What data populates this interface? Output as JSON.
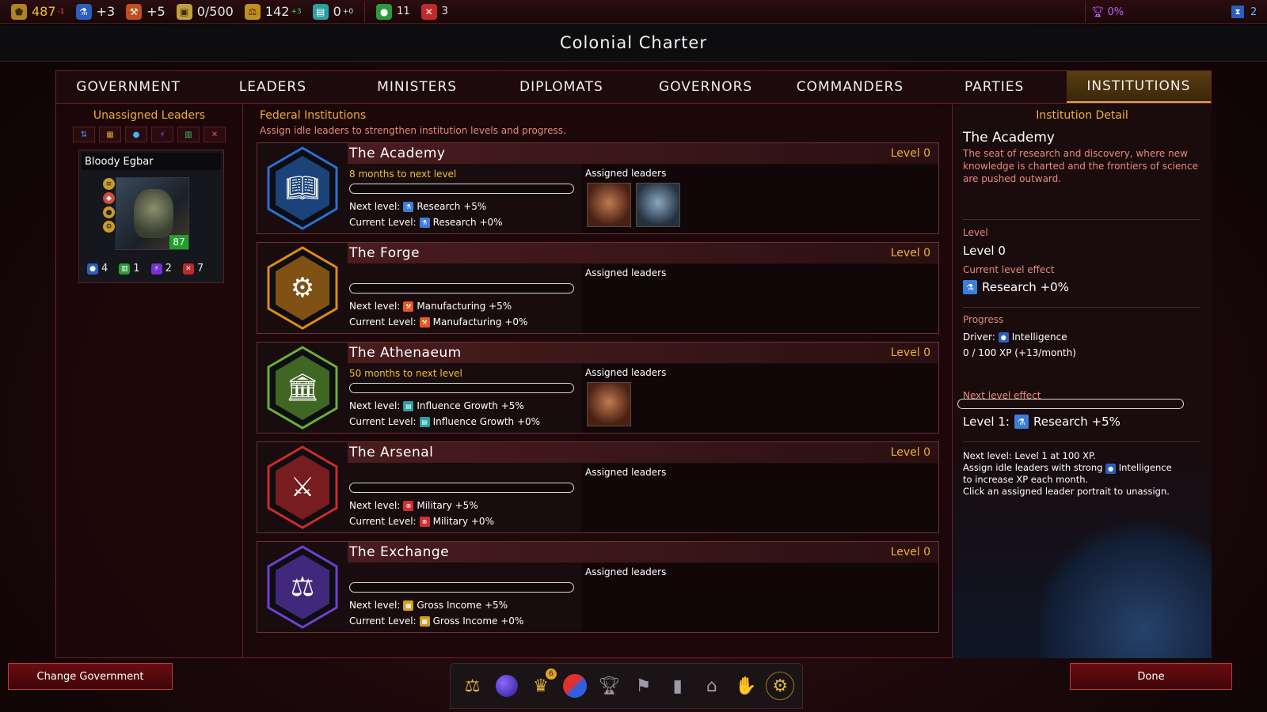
{
  "resources": [
    {
      "name": "credits",
      "value": "487",
      "delta": "-1",
      "color": "#f0c030",
      "delta_color": "#ff5050",
      "icon": "pentagon-coin-icon"
    },
    {
      "name": "research",
      "value": "+3",
      "delta": "",
      "color": "#ffffff",
      "icon": "flask-icon"
    },
    {
      "name": "manufacturing",
      "value": "+5",
      "delta": "",
      "color": "#ffffff",
      "icon": "hammer-icon"
    },
    {
      "name": "storage",
      "value": "0/500",
      "delta": "",
      "color": "#ffffff",
      "icon": "crate-icon"
    },
    {
      "name": "influence",
      "value": "142",
      "delta": "+3",
      "color": "#ffffff",
      "delta_color": "#40e040",
      "icon": "scales-icon"
    },
    {
      "name": "population",
      "value": "0",
      "delta": "+0",
      "color": "#ffffff",
      "delta_color": "#ffffff",
      "icon": "building-icon"
    }
  ],
  "resources_small": [
    {
      "name": "food",
      "value": "11",
      "icon": "apple-icon"
    },
    {
      "name": "unrest",
      "value": "3",
      "icon": "cross-swords-icon"
    }
  ],
  "topright": {
    "victory": "0%",
    "turns": "2"
  },
  "title": "Colonial Charter",
  "tabs": [
    "GOVERNMENT",
    "LEADERS",
    "MINISTERS",
    "DIPLOMATS",
    "GOVERNORS",
    "COMMANDERS",
    "PARTIES",
    "INSTITUTIONS"
  ],
  "active_tab": 7,
  "left": {
    "header": "Unassigned Leaders",
    "filter_icons": [
      "diplomacy-icon",
      "industry-icon",
      "intelligence-icon",
      "psionic-icon",
      "government-icon",
      "military-icon"
    ],
    "leader": {
      "name": "Bloody Egbar",
      "level": "87",
      "stats": [
        {
          "icon": "intelligence-icon",
          "value": "4"
        },
        {
          "icon": "government-icon",
          "value": "1"
        },
        {
          "icon": "psionic-icon",
          "value": "2"
        },
        {
          "icon": "military-icon",
          "value": "7"
        }
      ]
    }
  },
  "middle": {
    "header": "Federal Institutions",
    "subheader": "Assign idle leaders to strengthen institution levels and progress.",
    "assigned_label": "Assigned leaders",
    "next_prefix": "Next level:",
    "current_prefix": "Current Level:",
    "institutions": [
      {
        "name": "The Academy",
        "level": "Level 0",
        "months": "8 months to next level",
        "progress": 0.0,
        "next": "Research +5%",
        "current": "Research +0%",
        "effect_icon": "flask-icon",
        "effect_color": "#3a7fd8",
        "emblem": "book-emblem",
        "emblem_color": "#2a6fd0",
        "assigned": [
          "leader-portrait-red-warrior",
          "leader-portrait-blue-alien"
        ]
      },
      {
        "name": "The Forge",
        "level": "Level 0",
        "months": "",
        "progress": 0.0,
        "next": "Manufacturing +5%",
        "current": "Manufacturing +0%",
        "effect_icon": "hammer-icon",
        "effect_color": "#e05a20",
        "emblem": "factory-gear-emblem",
        "emblem_color": "#e08a18",
        "assigned": []
      },
      {
        "name": "The Athenaeum",
        "level": "Level 0",
        "months": "50 months to next level",
        "progress": 0.0,
        "next": "Influence Growth +5%",
        "current": "Influence Growth +0%",
        "effect_icon": "influence-icon",
        "effect_color": "#2aa0a0",
        "emblem": "temple-emblem",
        "emblem_color": "#6ab030",
        "assigned": [
          "leader-portrait-red-warrior"
        ]
      },
      {
        "name": "The Arsenal",
        "level": "Level 0",
        "months": "",
        "progress": 0.0,
        "next": "Military +5%",
        "current": "Military +0%",
        "effect_icon": "military-icon",
        "effect_color": "#d03030",
        "emblem": "crossed-swords-emblem",
        "emblem_color": "#d02a2a",
        "assigned": []
      },
      {
        "name": "The Exchange",
        "level": "Level 0",
        "months": "",
        "progress": 0.0,
        "next": "Gross Income +5%",
        "current": "Gross Income +0%",
        "effect_icon": "income-icon",
        "effect_color": "#d0a020",
        "emblem": "scales-emblem",
        "emblem_color": "#7040d0",
        "assigned": []
      }
    ]
  },
  "detail": {
    "header": "Institution Detail",
    "title": "The Academy",
    "description": "The seat of research and discovery, where new knowledge is charted and the frontiers of science are pushed outward.",
    "level_label": "Level",
    "level_value": "Level 0",
    "current_label": "Current level effect",
    "current_value": "Research +0%",
    "progress_label": "Progress",
    "driver_prefix": "Driver:",
    "driver_value": "Intelligence",
    "xp": "0 / 100 XP (+13/month)",
    "progress": 0.0,
    "next_label": "Next level effect",
    "next_prefix": "Level 1:",
    "next_value": "Research +5%",
    "note1": "Next level: Level 1 at 100 XP.",
    "note2_pre": "Assign idle leaders with strong",
    "note2_attr": "Intelligence",
    "note3": "to increase XP each month.",
    "note4": "Click an assigned leader portrait to unassign."
  },
  "buttons": {
    "change_government": "Change Government",
    "done": "Done"
  },
  "dock": [
    {
      "icon": "scales-dock-icon",
      "badge": ""
    },
    {
      "icon": "planet-dock-icon",
      "badge": ""
    },
    {
      "icon": "crown-dock-icon",
      "badge": "6"
    },
    {
      "icon": "trend-chart-dock-icon",
      "badge": ""
    },
    {
      "icon": "trophy-dock-icon",
      "badge": ""
    },
    {
      "icon": "flag-dock-icon",
      "badge": ""
    },
    {
      "icon": "pillar-dock-icon",
      "badge": ""
    },
    {
      "icon": "temple-dock-icon",
      "badge": ""
    },
    {
      "icon": "handshake-dock-icon",
      "badge": ""
    },
    {
      "icon": "government-dock-icon",
      "badge": ""
    }
  ]
}
